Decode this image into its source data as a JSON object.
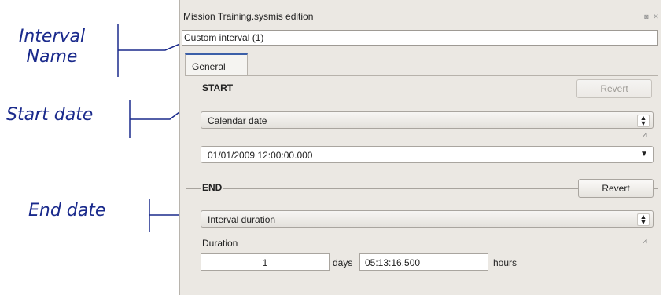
{
  "annotations": {
    "interval_name": "Interval Name",
    "start_date": "Start date",
    "end_date": "End date"
  },
  "window": {
    "title": "Mission Training.sysmis edition",
    "interval_name_value": "Custom interval (1)",
    "tab_general": "General"
  },
  "start": {
    "title": "START",
    "revert_label": "Revert",
    "revert_enabled": false,
    "date_type": "Calendar date",
    "date_value": "01/01/2009 12:00:00.000"
  },
  "end": {
    "title": "END",
    "revert_label": "Revert",
    "revert_enabled": true,
    "date_type": "Interval duration",
    "duration_label": "Duration",
    "days_value": "1",
    "days_unit": "days",
    "hours_value": "05:13:16.500",
    "hours_unit": "hours"
  },
  "icons": {
    "combo_arrows": "up-down-arrows-icon",
    "dropdown": "chevron-down-icon",
    "plot": "waveform-icon",
    "window_controls": [
      "detach-icon",
      "close-icon"
    ]
  },
  "colors": {
    "annotation": "#1a2a8c",
    "window_bg": "#ebe8e3",
    "tab_accent": "#3b5fa8"
  }
}
